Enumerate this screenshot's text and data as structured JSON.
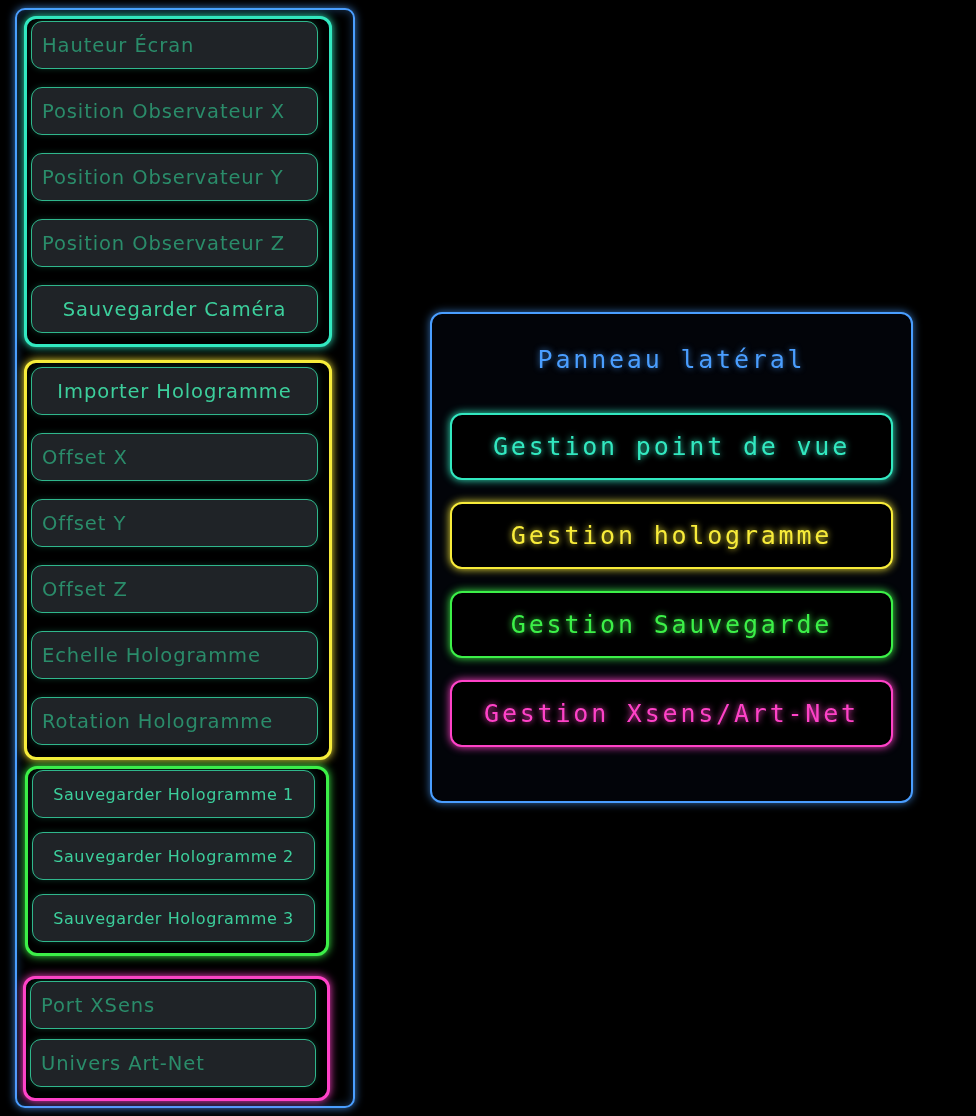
{
  "side_panel": {
    "groups": [
      {
        "color": "#32e8c0",
        "items": [
          {
            "kind": "field",
            "placeholder": "Hauteur Écran"
          },
          {
            "kind": "field",
            "placeholder": "Position Observateur X"
          },
          {
            "kind": "field",
            "placeholder": "Position Observateur Y"
          },
          {
            "kind": "field",
            "placeholder": "Position Observateur Z"
          },
          {
            "kind": "button",
            "label": "Sauvegarder Caméra"
          }
        ]
      },
      {
        "color": "#f8ec3a",
        "items": [
          {
            "kind": "button",
            "label": "Importer Hologramme"
          },
          {
            "kind": "field",
            "placeholder": "Offset X"
          },
          {
            "kind": "field",
            "placeholder": "Offset Y"
          },
          {
            "kind": "field",
            "placeholder": "Offset Z"
          },
          {
            "kind": "field",
            "placeholder": "Echelle Hologramme"
          },
          {
            "kind": "field",
            "placeholder": "Rotation Hologramme"
          }
        ]
      },
      {
        "color": "#3cf048",
        "items": [
          {
            "kind": "compact-button",
            "label": "Sauvegarder Hologramme 1"
          },
          {
            "kind": "compact-button",
            "label": "Sauvegarder Hologramme 2"
          },
          {
            "kind": "compact-button",
            "label": "Sauvegarder Hologramme 3"
          }
        ]
      },
      {
        "color": "#ff42c8",
        "items": [
          {
            "kind": "field",
            "placeholder": "Port XSens"
          },
          {
            "kind": "field",
            "placeholder": "Univers Art-Net"
          }
        ]
      }
    ]
  },
  "main_panel": {
    "title": "Panneau latéral",
    "buttons": [
      {
        "label": "Gestion point de vue",
        "color": "#32e8c0"
      },
      {
        "label": "Gestion hologramme",
        "color": "#f8ec3a"
      },
      {
        "label": "Gestion Sauvegarde",
        "color": "#3cf048"
      },
      {
        "label": "Gestion Xsens/Art-Net",
        "color": "#ff42c8"
      }
    ]
  }
}
